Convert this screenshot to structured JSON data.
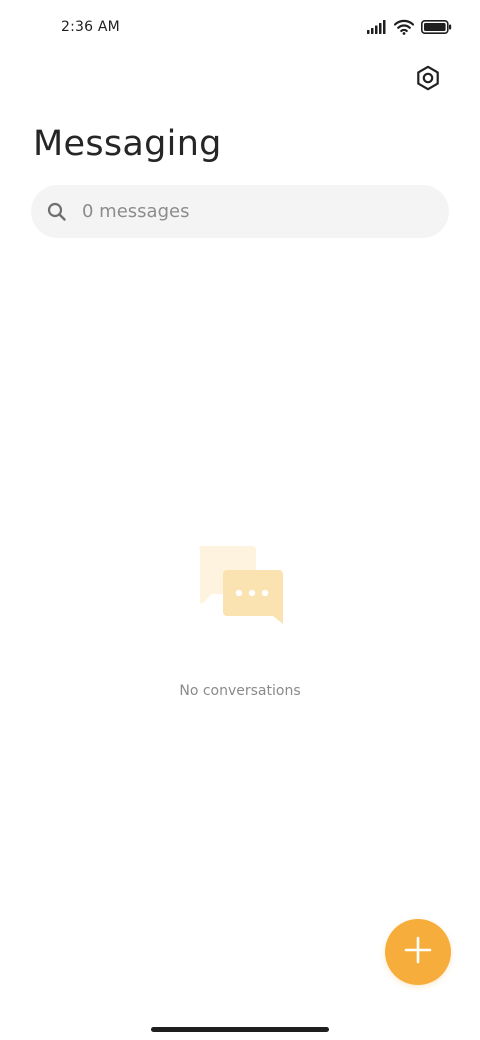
{
  "status_bar": {
    "time": "2:36 AM",
    "icons": [
      "signal-icon",
      "wifi-icon",
      "battery-icon"
    ]
  },
  "header": {
    "title": "Messaging",
    "settings_icon": "settings-icon"
  },
  "search": {
    "icon": "search-icon",
    "text": "0 messages"
  },
  "empty_state": {
    "illustration": "chat-bubbles-icon",
    "message": "No conversations"
  },
  "fab": {
    "icon": "plus-icon",
    "color": "#f7ad3c"
  },
  "colors": {
    "accent": "#f7ad3c",
    "search_background": "#f4f4f4",
    "illustration_back": "#fdf3de",
    "illustration_front": "#fbe3b1"
  }
}
